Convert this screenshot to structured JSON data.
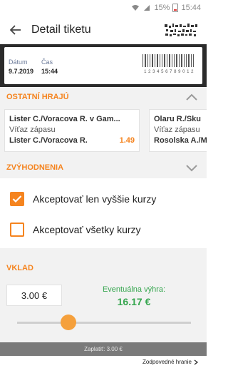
{
  "status_bar": {
    "battery": "15%",
    "time": "15:44"
  },
  "header": {
    "title": "Detail tiketu"
  },
  "ticket": {
    "date_label": "Dátum",
    "date_value": "9.7.2019",
    "time_label": "Čas",
    "time_value": "15:44",
    "barcode_number": "1 2 3 4 5 6 7 8 9 0 1 2"
  },
  "other_players": {
    "title": "OSTATNÍ HRAJÚ",
    "cards": [
      {
        "match": "Lister C./Voracova R. v Gam...",
        "market": "Víťaz zápasu",
        "selection": "Lister C./Voracova R.",
        "odds": "1.49"
      },
      {
        "match": "Olaru R./Sku",
        "market": "Víťaz zápasu",
        "selection": "Rosolska A./M",
        "odds": ""
      }
    ]
  },
  "bonuses": {
    "title": "ZVÝHODNENIA"
  },
  "options": [
    {
      "label": "Akceptovať len vyššie kurzy",
      "checked": true
    },
    {
      "label": "Akceptovať všetky kurzy",
      "checked": false
    }
  ],
  "stake": {
    "title": "VKLAD",
    "amount": "3.00 €",
    "potential_win_label": "Eventuálna výhra:",
    "potential_win_value": "16.17 €"
  },
  "pay_bar": {
    "text": "Zaplatiť: 3.00 €"
  },
  "footer": {
    "link": "Zodpovedné hranie"
  },
  "colors": {
    "accent": "#f5841f",
    "win": "#36a64f",
    "ticket_bg": "#2b2b2b"
  }
}
